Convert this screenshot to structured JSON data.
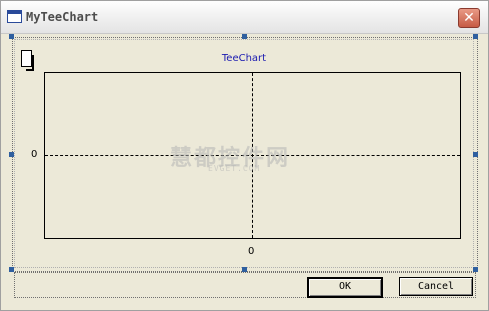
{
  "window": {
    "title": "MyTeeChart",
    "close_glyph": "✕"
  },
  "chart": {
    "title": "TeeChart",
    "y_tick": "0",
    "x_tick": "0"
  },
  "watermark": {
    "main": "慧都控件网",
    "sub": "EVGET.COM"
  },
  "buttons": {
    "ok": "OK",
    "cancel": "Cancel"
  },
  "chart_data": {
    "type": "line",
    "title": "TeeChart",
    "x_ticks": [
      "0"
    ],
    "y_ticks": [
      "0"
    ],
    "series": [],
    "grid": true
  }
}
